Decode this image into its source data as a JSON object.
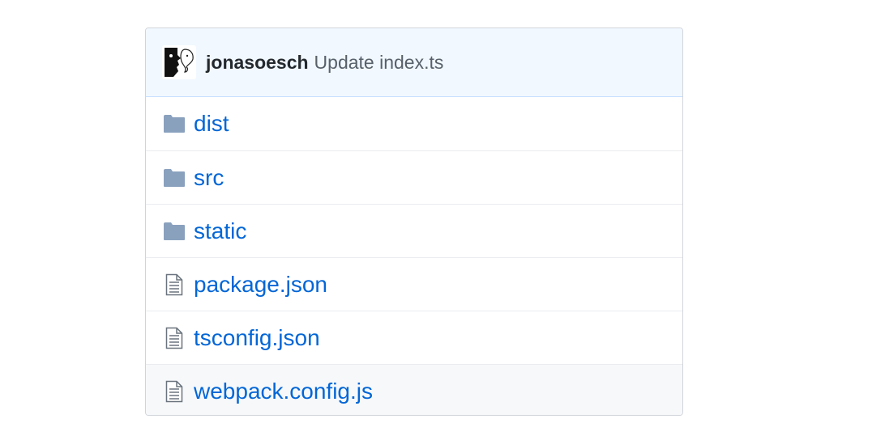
{
  "commit": {
    "author": "jonasoesch",
    "message": "Update index.ts",
    "avatar_icon": "user-avatar"
  },
  "files": [
    {
      "name": "dist",
      "type": "folder",
      "icon": "folder-icon"
    },
    {
      "name": "src",
      "type": "folder",
      "icon": "folder-icon"
    },
    {
      "name": "static",
      "type": "folder",
      "icon": "folder-icon"
    },
    {
      "name": "package.json",
      "type": "file",
      "icon": "file-text-icon"
    },
    {
      "name": "tsconfig.json",
      "type": "file",
      "icon": "file-text-icon"
    },
    {
      "name": "webpack.config.js",
      "type": "file",
      "icon": "file-text-icon",
      "hovered": true
    }
  ],
  "colors": {
    "link": "#0366d6",
    "folder_icon": "#79b8ff",
    "header_bg": "#f1f8ff",
    "hover_row_bg": "#f6f8fa"
  }
}
